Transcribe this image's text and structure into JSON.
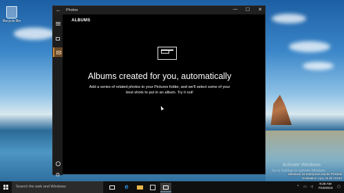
{
  "desktop": {
    "recycle_bin_label": "Recycle Bin",
    "watermark_line1": "Activate Windows",
    "watermark_line2": "Go to Settings to activate Windows.",
    "build_line1": "Windows 10 Enterprise Insider Preview",
    "build_line2": "Evaluation copy. Build 10162"
  },
  "window": {
    "title": "Photos",
    "back_icon": "back-arrow-icon",
    "controls": {
      "minimize": "—",
      "maximize": "☐",
      "close": "✕"
    }
  },
  "sidebar": {
    "items": [
      {
        "name": "menu",
        "icon": "hamburger-icon"
      },
      {
        "name": "collection",
        "icon": "collection-icon"
      },
      {
        "name": "albums",
        "icon": "album-icon",
        "selected": true
      },
      {
        "name": "account",
        "icon": "account-icon"
      },
      {
        "name": "settings",
        "icon": "gear-icon",
        "glyph": "⚙"
      }
    ],
    "accent_color": "#d0893a"
  },
  "main": {
    "section_title": "ALBUMS",
    "headline": "Albums created for you, automatically",
    "body": "Add a series of related photos to your Pictures folder, and we'll select some of your best shots to put in an album. Try it out!"
  },
  "taskbar": {
    "search_placeholder": "Search the web and Windows",
    "edge_glyph": "e",
    "tray": {
      "chevron": "^",
      "network": "▭",
      "volume": "◁",
      "notifications": "▢"
    },
    "time": "9:26 AM",
    "date": "7/15/2015"
  }
}
